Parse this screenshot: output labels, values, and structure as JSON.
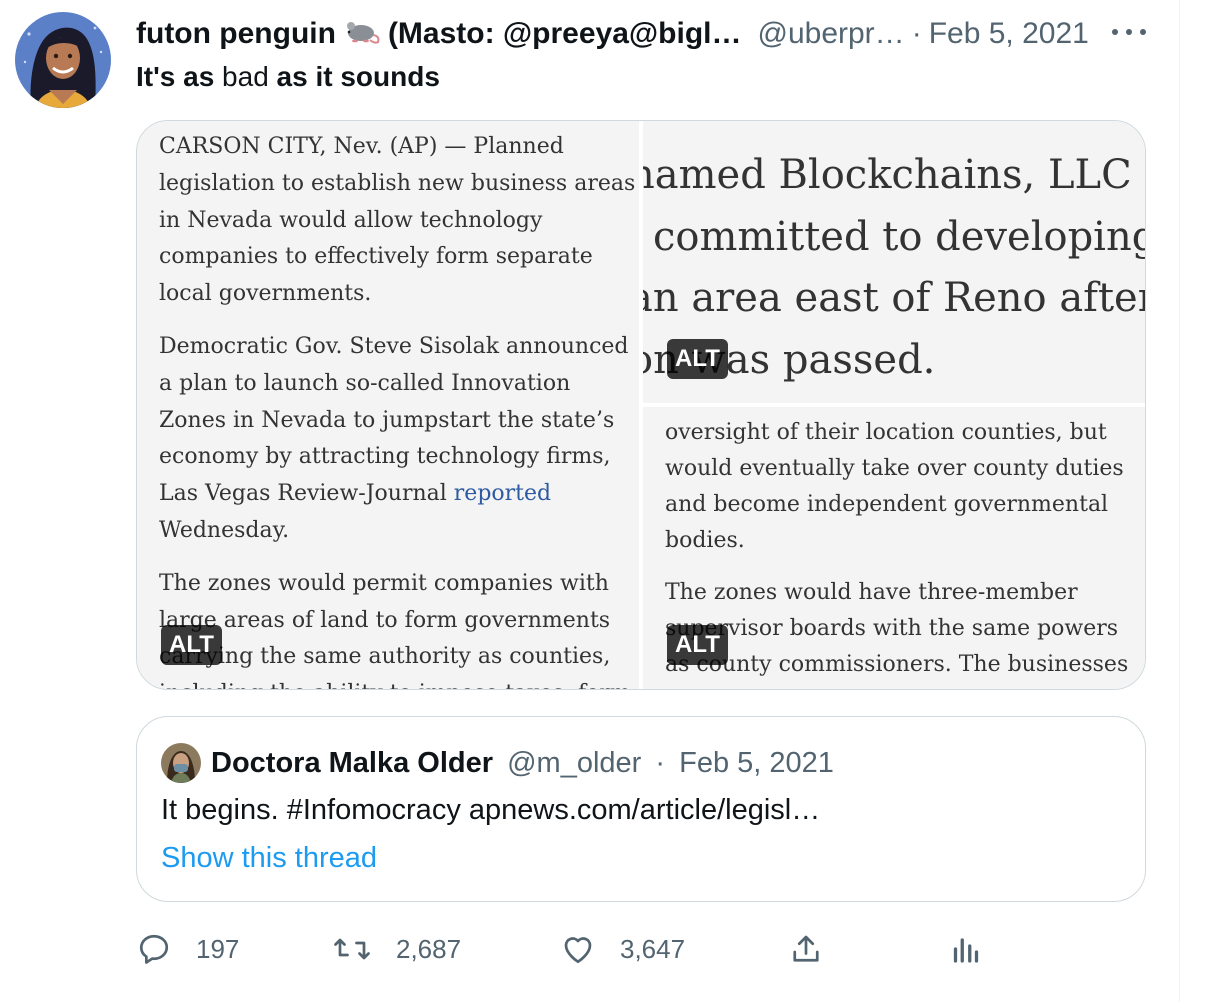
{
  "tweet": {
    "display_name": "futon penguin",
    "display_name_suffix": "(Masto: @preeya@bigl…",
    "handle": "@uberpr…",
    "separator": "·",
    "date": "Feb 5, 2021",
    "text_parts": [
      "It's",
      " as ",
      "bad ",
      "as it sounds"
    ]
  },
  "media": {
    "alt_label": "ALT",
    "left_article": {
      "p1": "CARSON CITY, Nev. (AP) — Planned legislation to establish new business areas in Nevada would allow technology companies to effectively form separate local governments.",
      "p2_before": "Democratic Gov. Steve Sisolak announced a plan to launch so-called Innovation Zones in Nevada to jumpstart the state’s economy by attracting technology firms, Las Vegas Review-Journal ",
      "p2_link": "reported",
      "p2_after": " Wednesday.",
      "p3": "The zones would permit companies with large areas of land to form governments carrying the same authority as counties, including the ability to impose taxes, form school districts and courts and provide government services."
    },
    "right_top_article": {
      "line1": "named Blockchains, LLC as a c",
      "line2": "committed to developing a “s",
      "line3": "an area east of Reno after the",
      "line4": "on was passed."
    },
    "right_bottom_article": {
      "p1": "oversight of their location counties, but would eventually take over county duties and become independent governmental bodies.",
      "p2": "The zones would have three-member supervisor boards with the same powers as county commissioners. The businesses would maintain significant control over board"
    }
  },
  "quote": {
    "name": "Doctora Malka Older",
    "handle": "@m_older",
    "separator": "·",
    "date": "Feb 5, 2021",
    "text": "It begins. #Infomocracy apnews.com/article/legisl…",
    "show_thread": "Show this thread"
  },
  "actions": {
    "replies": "197",
    "retweets": "2,687",
    "likes": "3,647"
  },
  "colors": {
    "text_primary": "#0f1419",
    "text_secondary": "#536471",
    "link_blue": "#1d9bf0",
    "border": "#cfd9de"
  }
}
